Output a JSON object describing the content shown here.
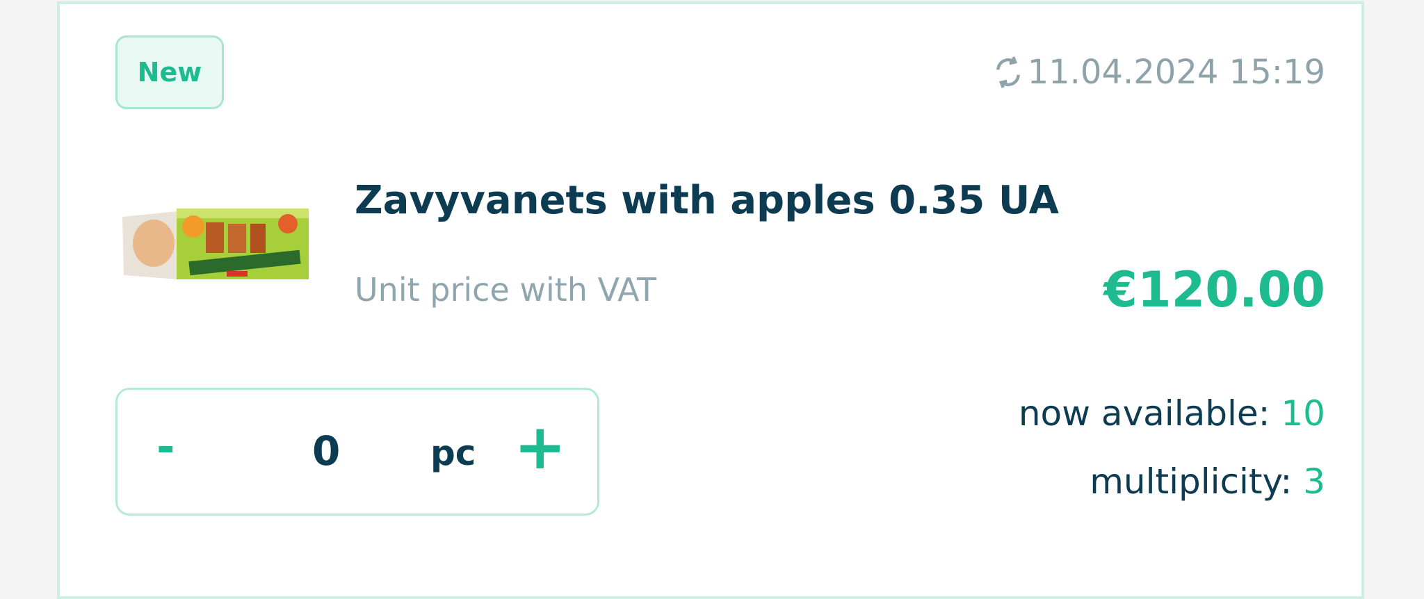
{
  "badge": {
    "label": "New"
  },
  "timestamp": {
    "icon": "refresh-icon",
    "value": "11.04.2024 15:19"
  },
  "product": {
    "title": "Zavyvanets with apples 0.35 UA",
    "price_label": "Unit price with VAT",
    "price": "€120.00"
  },
  "stepper": {
    "minus": "-",
    "value": "0",
    "unit": "pc",
    "plus": "+"
  },
  "stock": {
    "available_label": "now available:",
    "available_value": "10",
    "multiplicity_label": "multiplicity:",
    "multiplicity_value": "3"
  },
  "colors": {
    "accent": "#1dbb8f",
    "text": "#0d3c52",
    "muted": "#8ea2aa"
  }
}
